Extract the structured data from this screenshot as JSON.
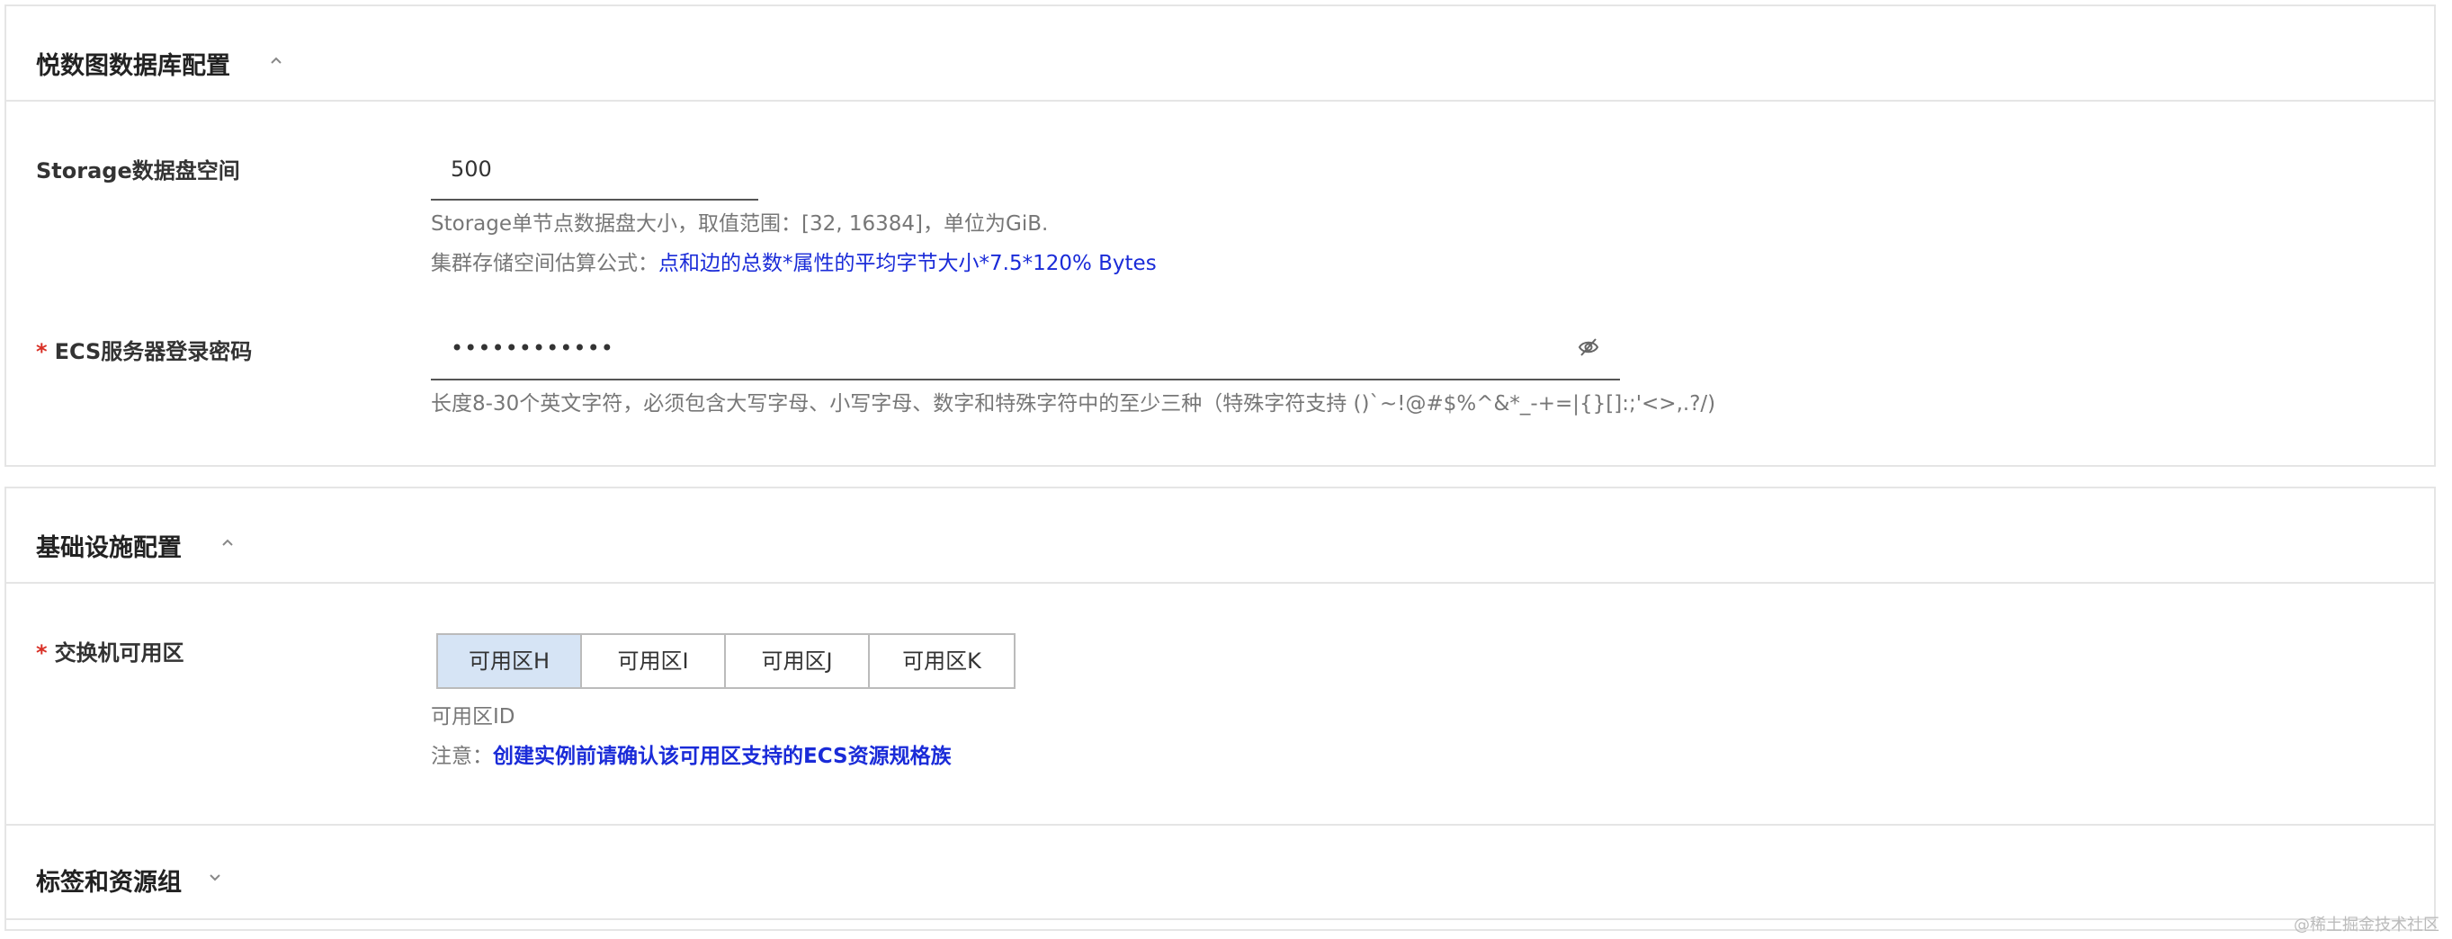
{
  "db_section": {
    "title": "悦数图数据库配置",
    "storage": {
      "label": "Storage数据盘空间",
      "value": "500",
      "help1": "Storage单节点数据盘大小，取值范围：[32, 16384]，单位为GiB.",
      "help2_prefix": "集群存储空间估算公式：",
      "help2_formula": "点和边的总数*属性的平均字节大小*7.5*120% Bytes"
    },
    "password": {
      "required_mark": "*",
      "label": "ECS服务器登录密码",
      "value": "••••••••••••",
      "icon": "eye-off-icon",
      "help": "长度8-30个英文字符，必须包含大写字母、小写字母、数字和特殊字符中的至少三种（特殊字符支持 ()`~!@#$%^&*_-+=|{}[]:;'<>,.?/)"
    }
  },
  "infra_section": {
    "title": "基础设施配置",
    "zone": {
      "required_mark": "*",
      "label": "交换机可用区",
      "options": [
        "可用区H",
        "可用区I",
        "可用区J",
        "可用区K"
      ],
      "selected": "可用区H",
      "sub_label": "可用区ID",
      "note_prefix": "注意：",
      "note_link": "创建实例前请确认该可用区支持的ECS资源规格族"
    }
  },
  "tags_section": {
    "title": "标签和资源组"
  },
  "watermark": "@稀土掘金技术社区",
  "colors": {
    "link": "#1a2bd8",
    "required": "#d93026",
    "selected_zone_bg": "#d6e4f5"
  }
}
